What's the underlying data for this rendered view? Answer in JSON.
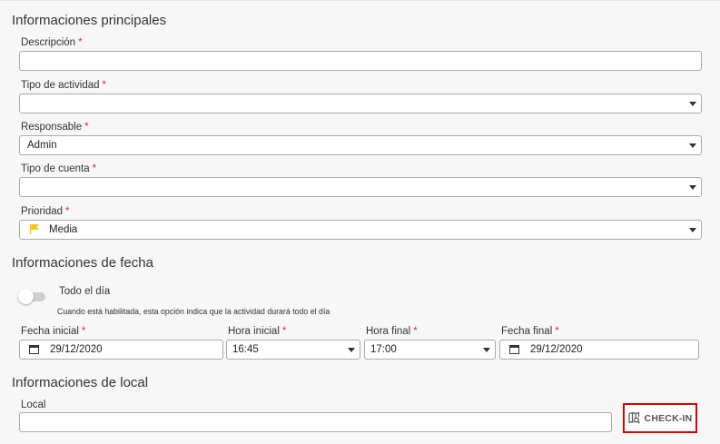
{
  "sections": {
    "main": "Informaciones principales",
    "date": "Informaciones de fecha",
    "location": "Informaciones de local"
  },
  "fields": {
    "descripcion": {
      "label": "Descripción",
      "value": ""
    },
    "tipo_actividad": {
      "label": "Tipo de actividad",
      "value": ""
    },
    "responsable": {
      "label": "Responsable",
      "value": "Admin"
    },
    "tipo_cuenta": {
      "label": "Tipo de cuenta",
      "value": ""
    },
    "prioridad": {
      "label": "Prioridad",
      "value": "Media",
      "flag_color": "#f5c518"
    }
  },
  "required_mark": "*",
  "all_day": {
    "label": "Todo el día",
    "hint": "Cuando está habilitada, esta opción indica que la actividad durará todo el día",
    "enabled": false
  },
  "dates": {
    "fecha_inicial": {
      "label": "Fecha inicial",
      "value": "29/12/2020"
    },
    "hora_inicial": {
      "label": "Hora inicial",
      "value": "16:45"
    },
    "hora_final": {
      "label": "Hora final",
      "value": "17:00"
    },
    "fecha_final": {
      "label": "Fecha final",
      "value": "29/12/2020"
    }
  },
  "local": {
    "label": "Local",
    "value": ""
  },
  "checkin": {
    "label": "CHECK-IN",
    "icon": "map-search-icon",
    "highlight_color": "#e00000"
  }
}
